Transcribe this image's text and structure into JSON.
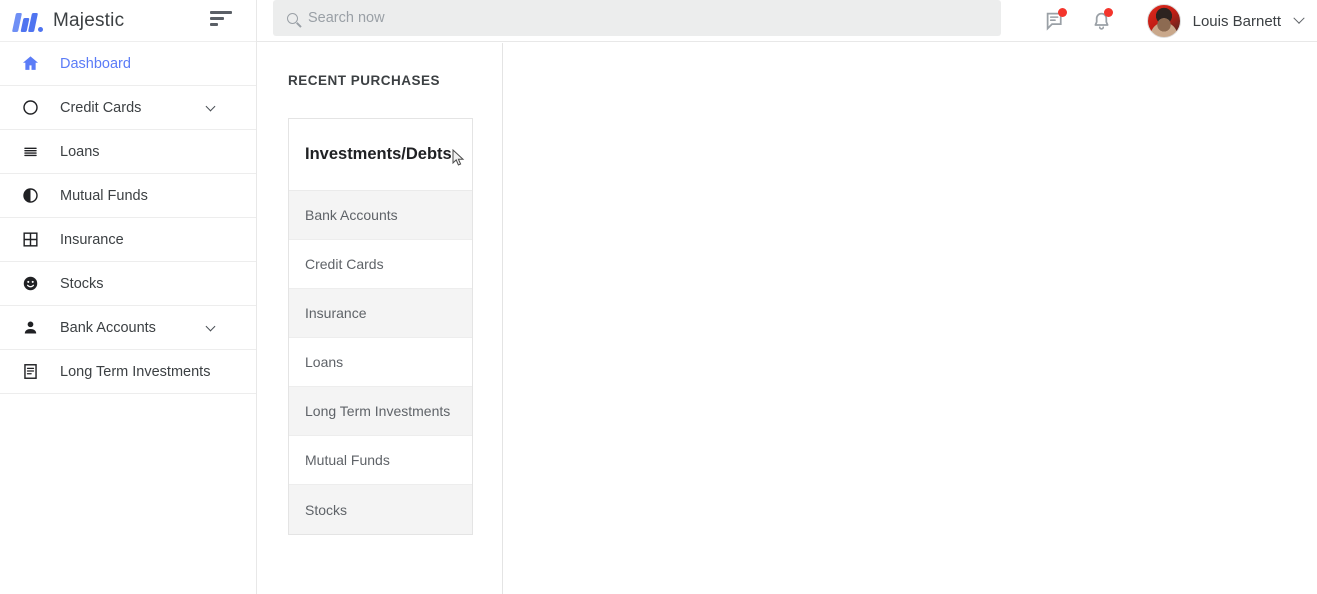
{
  "brand": {
    "name": "Majestic",
    "logo_icon": "majestic-logo",
    "menu_toggle_icon": "hamburger-icon"
  },
  "header": {
    "search": {
      "placeholder": "Search now",
      "value": "",
      "icon": "search-icon"
    },
    "messages_icon": "message-icon",
    "notifications_icon": "bell-icon",
    "user": {
      "name": "Louis Barnett",
      "avatar_icon": "avatar",
      "chevron_icon": "chevron-down-icon"
    },
    "badge_color": "#f4352c"
  },
  "sidebar": {
    "items": [
      {
        "label": "Dashboard",
        "icon": "home-icon",
        "active": true,
        "expandable": false
      },
      {
        "label": "Credit Cards",
        "icon": "circle-icon",
        "active": false,
        "expandable": true
      },
      {
        "label": "Loans",
        "icon": "list-icon",
        "active": false,
        "expandable": false
      },
      {
        "label": "Mutual Funds",
        "icon": "pie-chart-icon",
        "active": false,
        "expandable": false
      },
      {
        "label": "Insurance",
        "icon": "grid-icon",
        "active": false,
        "expandable": false
      },
      {
        "label": "Stocks",
        "icon": "smiley-icon",
        "active": false,
        "expandable": false
      },
      {
        "label": "Bank Accounts",
        "icon": "person-icon",
        "active": false,
        "expandable": true
      },
      {
        "label": "Long Term Investments",
        "icon": "document-icon",
        "active": false,
        "expandable": false
      }
    ],
    "active_color": "#5b7cf7"
  },
  "main": {
    "section_title": "RECENT PURCHASES",
    "card": {
      "title": "Investments/Debts",
      "rows": [
        "Bank Accounts",
        "Credit Cards",
        "Insurance",
        "Loans",
        "Long Term Investments",
        "Mutual Funds",
        "Stocks"
      ]
    }
  }
}
